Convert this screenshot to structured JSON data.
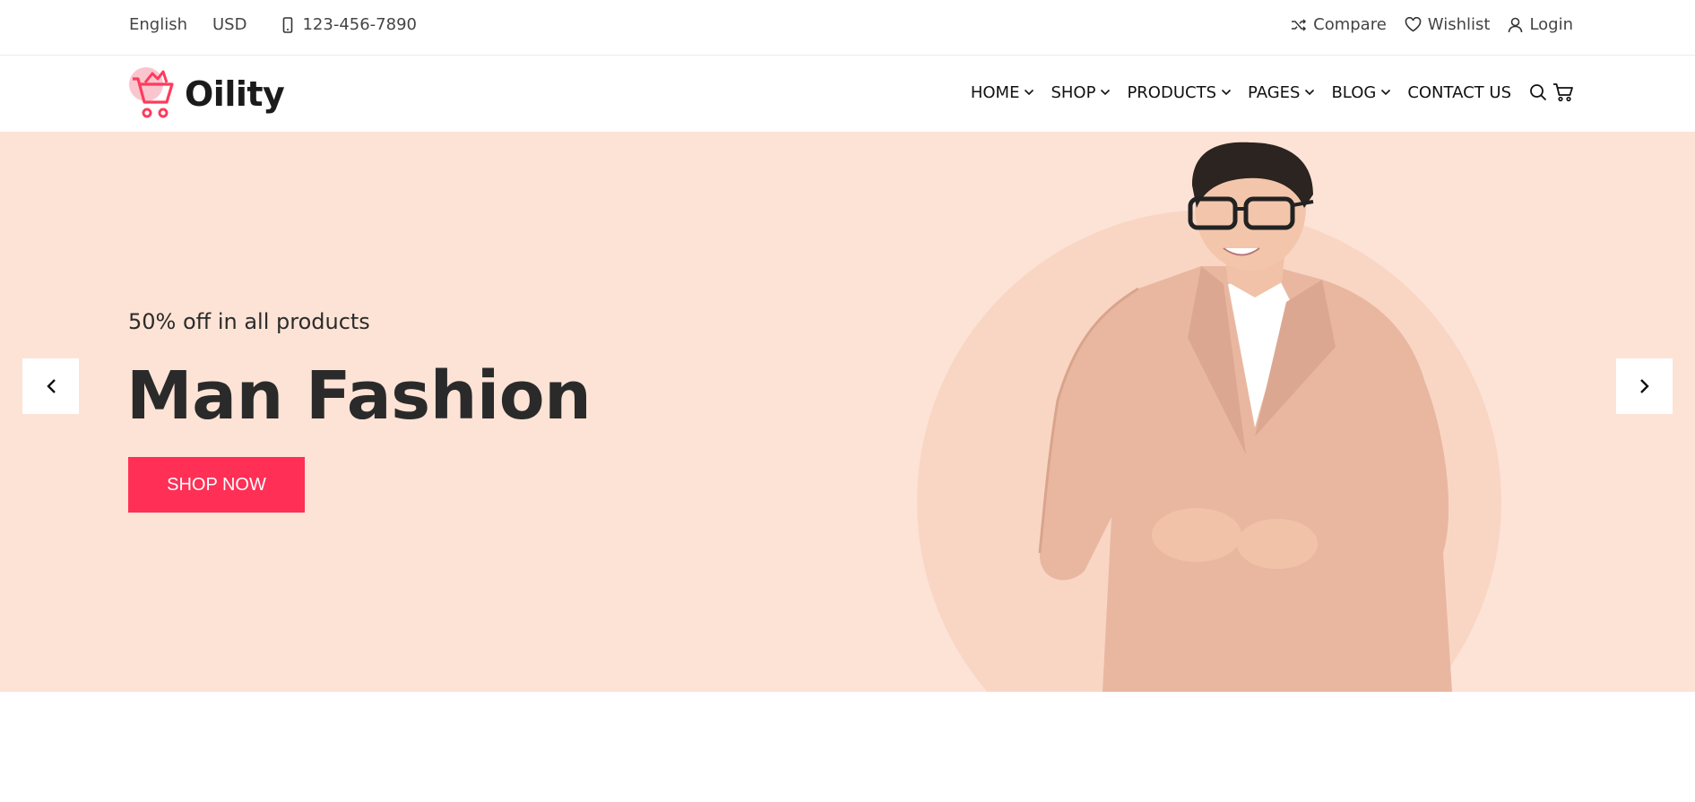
{
  "topbar": {
    "language": "English",
    "currency": "USD",
    "phone": "123-456-7890",
    "links": [
      {
        "label": "Compare",
        "icon": "shuffle-icon"
      },
      {
        "label": "Wishlist",
        "icon": "heart-icon"
      },
      {
        "label": "Login",
        "icon": "user-icon"
      }
    ]
  },
  "header": {
    "logo_text": "Oility",
    "nav": [
      {
        "label": "HOME",
        "dropdown": true
      },
      {
        "label": "SHOP",
        "dropdown": true
      },
      {
        "label": "PRODUCTS",
        "dropdown": true
      },
      {
        "label": "PAGES",
        "dropdown": true
      },
      {
        "label": "BLOG",
        "dropdown": true
      },
      {
        "label": "CONTACT US",
        "dropdown": false
      }
    ],
    "icons": [
      "search-icon",
      "cart-icon"
    ]
  },
  "hero": {
    "subtitle": "50% off in all products",
    "title": "Man Fashion",
    "cta_label": "SHOP NOW",
    "colors": {
      "background": "#fde3d6",
      "accent": "#ff2f55"
    }
  }
}
